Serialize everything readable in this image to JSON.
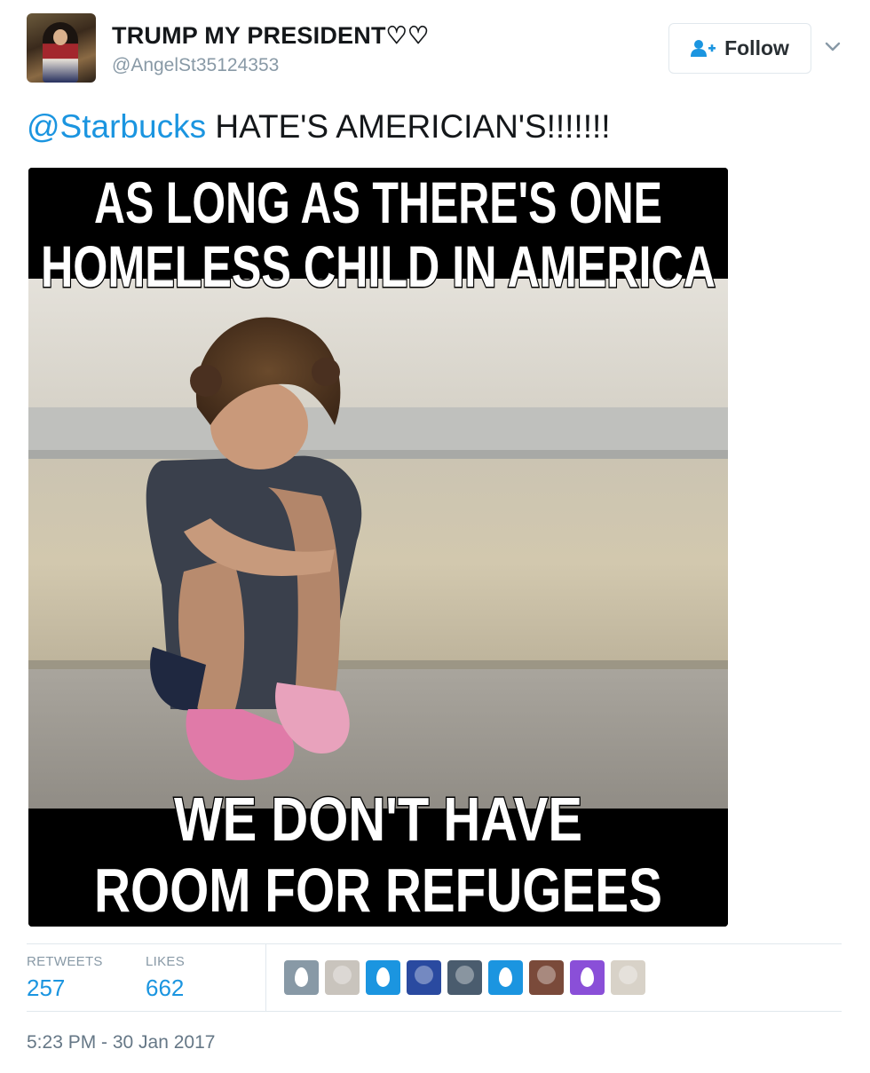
{
  "author": {
    "display_name": "TRUMP MY PRESIDENT♡♡",
    "handle": "@AngelSt35124353"
  },
  "follow_button": {
    "label": "Follow",
    "icon": "add-user-icon"
  },
  "tweet": {
    "mention": "@Starbucks",
    "text": " HATE'S AMERICIAN'S!!!!!!!"
  },
  "media": {
    "top_caption_line1": "AS LONG AS THERE'S ONE",
    "top_caption_line2": "HOMELESS CHILD IN AMERICA",
    "bottom_caption_line1": "WE DON'T HAVE",
    "bottom_caption_line2": "ROOM FOR REFUGEES"
  },
  "stats": {
    "retweets_label": "RETWEETS",
    "retweets_value": "257",
    "likes_label": "LIKES",
    "likes_value": "662"
  },
  "likers": [
    {
      "name": "default-egg-gray",
      "color": "#8899a6"
    },
    {
      "name": "photo-avatar",
      "color": "#c9c4bd"
    },
    {
      "name": "default-egg-blue",
      "color": "#1b95e0"
    },
    {
      "name": "flag-avatar",
      "color": "#2a4aa0"
    },
    {
      "name": "photo-avatar",
      "color": "#4a5c6e"
    },
    {
      "name": "default-egg-blue",
      "color": "#1b95e0"
    },
    {
      "name": "photo-avatar",
      "color": "#7a4a3a"
    },
    {
      "name": "default-egg-purple",
      "color": "#8a4fd8"
    },
    {
      "name": "photo-avatar",
      "color": "#d8d2c8"
    }
  ],
  "timestamp": "5:23 PM - 30 Jan 2017",
  "colors": {
    "link": "#1b95e0",
    "muted": "#8899a6",
    "border": "#e1e8ed"
  }
}
